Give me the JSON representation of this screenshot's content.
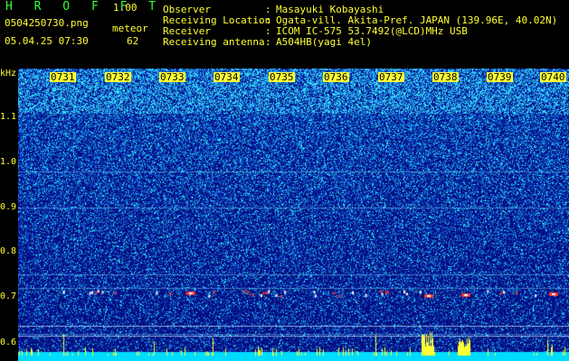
{
  "app": {
    "logo": "H R O F F T",
    "version": "1.00",
    "filename": "0504250730.png",
    "datetime": "05.04.25 07:30",
    "detector_label": "meteor",
    "detector_count": "62"
  },
  "info": {
    "rows": [
      {
        "label": "Observer",
        "sep": ":",
        "value": "Masayuki Kobayashi"
      },
      {
        "label": "Receiving Location",
        "sep": ":",
        "value": "Ogata-vill. Akita-Pref. JAPAN (139.96E, 40.02N)"
      },
      {
        "label": "Receiver",
        "sep": ":",
        "value": "ICOM IC-575 53.7492(@LCD)MHz USB"
      },
      {
        "label": "Receiving antenna",
        "sep": ":",
        "value": "A504HB(yagi 4el)"
      }
    ]
  },
  "spectrogram": {
    "y_unit": "kHz",
    "y_ticks": [
      "1.1",
      "1.0",
      "0.9",
      "0.8",
      "0.7",
      "0.6"
    ],
    "x_ticks": [
      "0731",
      "0732",
      "0733",
      "0734",
      "0735",
      "0736",
      "0737",
      "0738",
      "0739",
      "0740"
    ],
    "colors": {
      "bg": "#0a0a8a",
      "noise_hi": "#33ccff",
      "signal": "#ff3333",
      "bottom_bar": "#00e5ff",
      "peaks": "#ffff33"
    }
  }
}
